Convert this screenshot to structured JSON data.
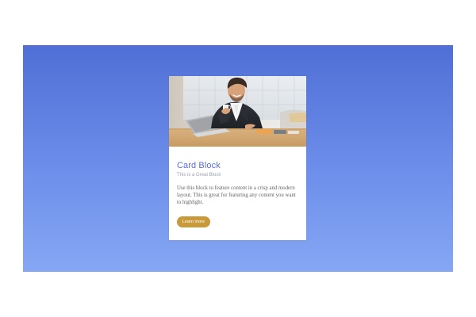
{
  "colors": {
    "background_top": "#4f6fd6",
    "background_bottom": "#86a7f4",
    "card_title": "#5b6fd6",
    "button": "#c89a3a",
    "card_bg": "#ffffff"
  },
  "card": {
    "title": "Card Block",
    "subtitle": "This is a Great Block",
    "text": "Use this block to feature content in a crisp and modern layout. This is great for featuring any content you want to highlight.",
    "button_label": "Learn more"
  }
}
